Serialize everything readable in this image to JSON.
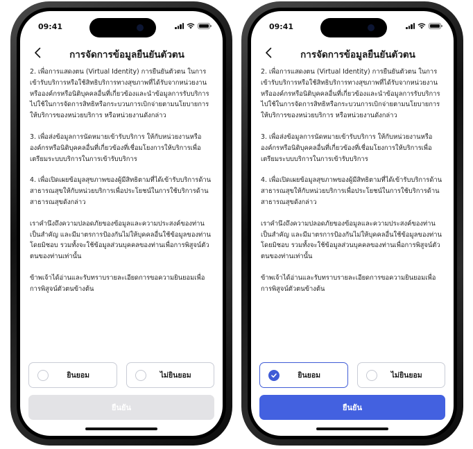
{
  "status_bar": {
    "time": "09:41"
  },
  "header": {
    "title": "การจัดการข้อมูลยืนยันตัวตน"
  },
  "paragraphs": [
    "2. เพื่อการแสดงตน (Virtual Identity) การยืนยันตัวตน ในการเข้ารับบริการหรือใช้สิทธิบริการทางสุขภาพที่ได้รับจากหน่วยงานหรือองค์กรหรือนิติบุคคลอื่นที่เกี่ยวข้องและนำข้อมูลการรับบริการไปใช้ในการจัดการสิทธิหรือกระบวนการเบิกจ่ายตามนโยบายการให้บริการของหน่วยบริการ หรือหน่วยงานดังกล่าว",
    "3. เพื่อส่งข้อมูลการนัดหมายเข้ารับบริการ ให้กับหน่วยงานหรือองค์กรหรือนิติบุคคลอื่นที่เกี่ยวข้องที่เชื่อมโยงการให้บริการเพื่อเตรียมระบบบริการในการเข้ารับบริการ",
    "4. เพื่อเปิดเผยข้อมูลสุขภาพของผู้มีสิทธิตามที่ได้เข้ารับบริการด้านสาธารณสุขให้กับหน่วยบริการเพื่อประโยชน์ในการใช้บริการด้านสาธารณสุขดังกล่าว",
    "เราคำนึงถึงความปลอดภัยของข้อมูลและความประสงค์ของท่านเป็นสำคัญ และมีมาตรการป้องกันไม่ให้บุคคลอื่นใช้ข้อมูลของท่านโดยมิชอบ รวมทั้งจะใช้ข้อมูลส่วนบุคคลของท่านเพื่อการพิสูจน์ตัวตนของท่านเท่านั้น",
    "ข้าพเจ้าได้อ่านและรับทราบรายละเอียดการขอความยินยอมเพื่อการพิสูจน์ตัวตนข้างต้น"
  ],
  "choices": {
    "accept": "ยินยอม",
    "decline": "ไม่ยินยอม"
  },
  "confirm_label": "ยืนยัน",
  "left_screen": {
    "selected": "none",
    "confirm_enabled": false
  },
  "right_screen": {
    "selected": "accept",
    "confirm_enabled": true
  },
  "colors": {
    "accent": "#4361e0",
    "disabled": "#e3e3e6",
    "text": "#222222",
    "border": "#c9ccd6"
  },
  "icons": [
    "back-chevron-icon",
    "signal-icon",
    "wifi-icon",
    "battery-icon",
    "check-icon"
  ]
}
